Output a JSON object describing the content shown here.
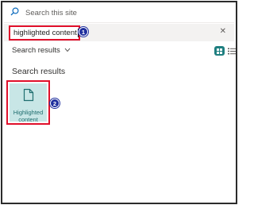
{
  "site_search": {
    "placeholder": "Search this site"
  },
  "query": {
    "value": "highlighted content"
  },
  "scope": {
    "label": "Search results"
  },
  "results": {
    "heading": "Search results",
    "items": [
      {
        "label_line1": "Highlighted",
        "label_line2": "content"
      }
    ]
  },
  "annotations": {
    "step1": "1",
    "step2": "2"
  },
  "colors": {
    "accent": "#1f7f80",
    "highlight": "#e0102b",
    "tile_bg": "#c8e6e6",
    "badge": "#1f2f9e"
  },
  "icons": {
    "site_search": "search-icon",
    "clear": "close-icon",
    "scope_dropdown": "chevron-down-icon",
    "grid_view": "grid-view-icon",
    "list_view": "list-view-icon",
    "result": "document-icon"
  }
}
